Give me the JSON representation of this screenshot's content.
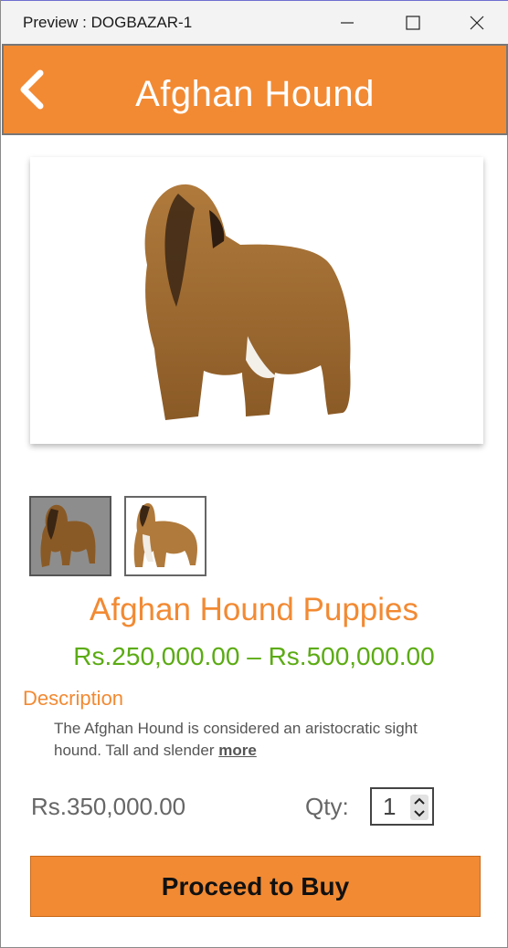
{
  "window": {
    "title": "Preview : DOGBAZAR-1"
  },
  "header": {
    "title": "Afghan Hound",
    "back_icon": "chevron-left-icon"
  },
  "product": {
    "name": "Afghan Hound Puppies",
    "price_range": "Rs.250,000.00 – Rs.500,000.00",
    "description_label": "Description",
    "description_text": "The Afghan Hound is considered an aristocratic sight hound. Tall and slender ",
    "more_link": "more",
    "price": "Rs.350,000.00",
    "qty_label": "Qty:",
    "qty_value": "1",
    "buy_label": "Proceed to Buy"
  },
  "colors": {
    "accent": "#f28a33",
    "price_green": "#5bab13",
    "text_gray": "#555555"
  }
}
